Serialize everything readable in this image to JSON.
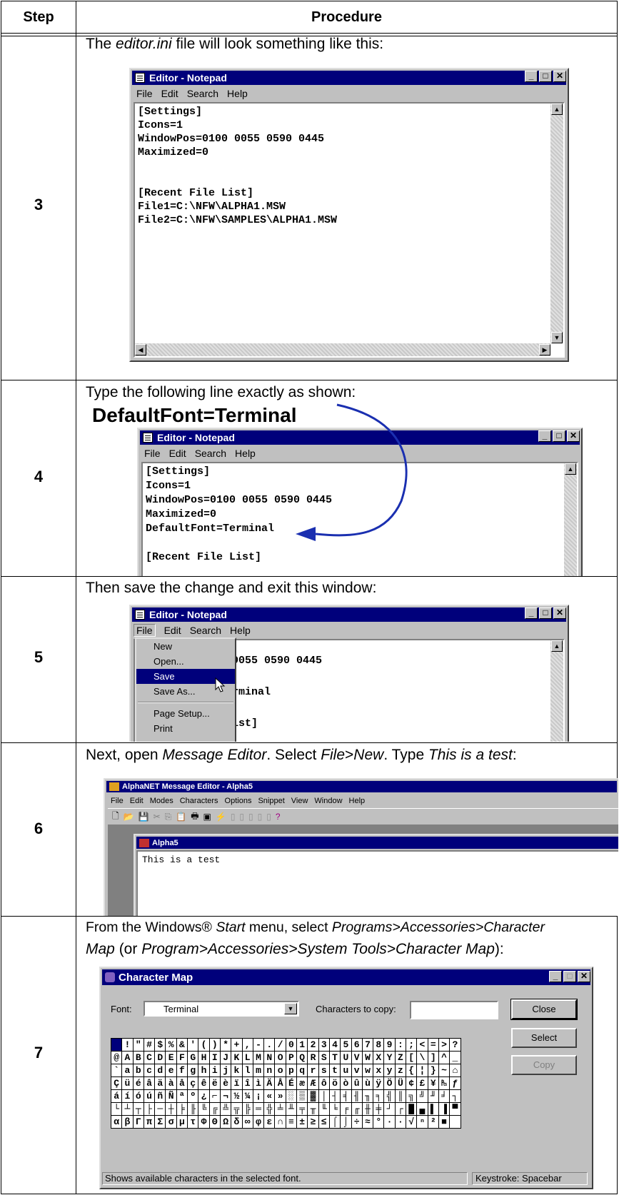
{
  "header": {
    "step": "Step",
    "procedure": "Procedure"
  },
  "rows": [
    {
      "step": "3",
      "intro_pre": "The ",
      "intro_em": "editor.ini",
      "intro_post": " file will look something like this:",
      "window": {
        "title": "Editor - Notepad",
        "menu": [
          "File",
          "Edit",
          "Search",
          "Help"
        ],
        "lines": [
          "[Settings]",
          "Icons=1",
          "WindowPos=0100 0055 0590 0445",
          "Maximized=0",
          "",
          "",
          "[Recent File List]",
          "File1=C:\\NFW\\ALPHA1.MSW",
          "File2=C:\\NFW\\SAMPLES\\ALPHA1.MSW"
        ]
      }
    },
    {
      "step": "4",
      "intro": "Type the following line exactly as shown:",
      "highlight": "DefaultFont=Terminal",
      "window": {
        "title": "Editor - Notepad",
        "menu": [
          "File",
          "Edit",
          "Search",
          "Help"
        ],
        "lines": [
          "[Settings]",
          "Icons=1",
          "WindowPos=0100 0055 0590 0445",
          "Maximized=0",
          "DefaultFont=Terminal",
          "",
          "[Recent File List]"
        ]
      }
    },
    {
      "step": "5",
      "intro": "Then save the change and exit this window:",
      "window": {
        "title": "Editor - Notepad",
        "menu": [
          "File",
          "Edit",
          "Search",
          "Help"
        ],
        "visible_lines": [
          "0055 0590 0445",
          "",
          "rminal",
          "",
          "ist]"
        ],
        "file_menu": [
          "New",
          "Open...",
          "Save",
          "Save As...",
          "Page Setup...",
          "Print"
        ]
      }
    },
    {
      "step": "6",
      "intro_parts": [
        "Next, open ",
        "Message Editor",
        ". Select ",
        "File",
        ">",
        "New",
        ". Type ",
        "This is a test",
        ":"
      ],
      "window": {
        "title": "AlphaNET Message Editor - Alpha5",
        "menu": [
          "File",
          "Edit",
          "Modes",
          "Characters",
          "Options",
          "Snippet",
          "View",
          "Window",
          "Help"
        ],
        "child_title": "Alpha5",
        "text": "This is a test"
      }
    },
    {
      "step": "7",
      "intro_line1_parts": [
        "From the Windows® ",
        "Start",
        " menu, select ",
        "Programs>Accessories>Character"
      ],
      "intro_line2_parts": [
        "Map",
        " (or ",
        "Program>Accessories>System Tools>Character Map",
        "):"
      ],
      "window": {
        "title": "Character Map",
        "font_label": "Font:",
        "font_value": "Terminal",
        "chars_label": "Characters to copy:",
        "buttons": [
          "Close",
          "Select",
          "Copy"
        ],
        "grid": [
          [
            " ",
            "!",
            "\"",
            "#",
            "$",
            "%",
            "&",
            "'",
            "(",
            ")",
            "*",
            "+",
            ",",
            "-",
            ".",
            "/",
            "0",
            "1",
            "2",
            "3",
            "4",
            "5",
            "6",
            "7",
            "8",
            "9",
            ":",
            ";",
            "<",
            "=",
            ">",
            "?"
          ],
          [
            "@",
            "A",
            "B",
            "C",
            "D",
            "E",
            "F",
            "G",
            "H",
            "I",
            "J",
            "K",
            "L",
            "M",
            "N",
            "O",
            "P",
            "Q",
            "R",
            "S",
            "T",
            "U",
            "V",
            "W",
            "X",
            "Y",
            "Z",
            "[",
            "\\",
            "]",
            "^",
            "_"
          ],
          [
            "`",
            "a",
            "b",
            "c",
            "d",
            "e",
            "f",
            "g",
            "h",
            "i",
            "j",
            "k",
            "l",
            "m",
            "n",
            "o",
            "p",
            "q",
            "r",
            "s",
            "t",
            "u",
            "v",
            "w",
            "x",
            "y",
            "z",
            "{",
            "¦",
            "}",
            "~",
            "⌂"
          ],
          [
            "Ç",
            "ü",
            "é",
            "â",
            "ä",
            "à",
            "å",
            "ç",
            "ê",
            "ë",
            "è",
            "ï",
            "î",
            "ì",
            "Ä",
            "Å",
            "É",
            "æ",
            "Æ",
            "ô",
            "ö",
            "ò",
            "û",
            "ù",
            "ÿ",
            "Ö",
            "Ü",
            "¢",
            "£",
            "¥",
            "₧",
            "ƒ"
          ],
          [
            "á",
            "í",
            "ó",
            "ú",
            "ñ",
            "Ñ",
            "ª",
            "º",
            "¿",
            "⌐",
            "¬",
            "½",
            "¼",
            "¡",
            "«",
            "»",
            "░",
            "▒",
            "▓",
            "│",
            "┤",
            "╡",
            "╢",
            "╖",
            "╕",
            "╣",
            "║",
            "╗",
            "╝",
            "╜",
            "╛",
            "┐"
          ],
          [
            "└",
            "┴",
            "┬",
            "├",
            "─",
            "┼",
            "╞",
            "╟",
            "╚",
            "╔",
            "╩",
            "╦",
            "╠",
            "═",
            "╬",
            "╧",
            "╨",
            "╤",
            "╥",
            "╙",
            "╘",
            "╒",
            "╓",
            "╫",
            "╪",
            "┘",
            "┌",
            "█",
            "▄",
            "▌",
            "▐",
            "▀"
          ],
          [
            "α",
            "β",
            "Γ",
            "π",
            "Σ",
            "σ",
            "µ",
            "τ",
            "Φ",
            "Θ",
            "Ω",
            "δ",
            "∞",
            "φ",
            "ε",
            "∩",
            "≡",
            "±",
            "≥",
            "≤",
            "⌠",
            "⌡",
            "÷",
            "≈",
            "°",
            "∙",
            "·",
            "√",
            "ⁿ",
            "²",
            "■",
            " "
          ]
        ],
        "status_left": "Shows available characters in the selected font.",
        "status_right": "Keystroke: Spacebar"
      }
    }
  ]
}
